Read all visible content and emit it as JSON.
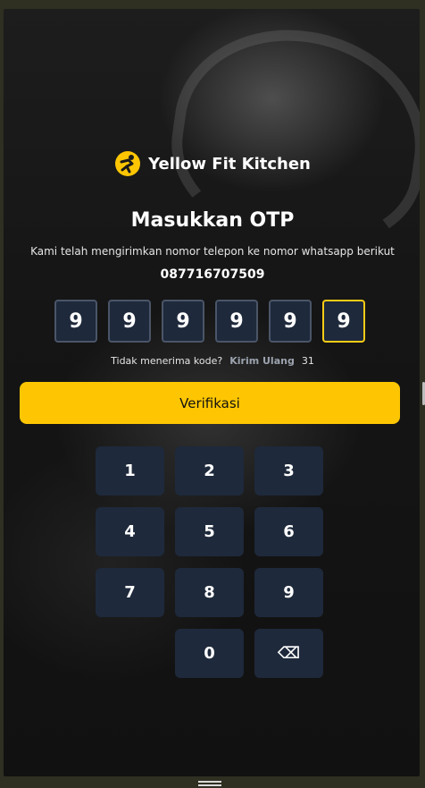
{
  "brand": {
    "name": "Yellow Fit Kitchen",
    "logo_icon": "running-person-icon",
    "accent_color": "#fec602"
  },
  "heading": {
    "title": "Masukkan OTP",
    "description": "Kami telah mengirimkan nomor telepon ke nomor whatsapp berikut",
    "phone_number": "087716707509"
  },
  "otp": {
    "digits": [
      "9",
      "9",
      "9",
      "9",
      "9",
      "9"
    ],
    "active_index": 5
  },
  "resend": {
    "prompt": "Tidak menerima kode?",
    "link_label": "Kirim Ulang",
    "countdown": "31"
  },
  "verify_button": {
    "label": "Verifikasi"
  },
  "keypad": {
    "keys": [
      "1",
      "2",
      "3",
      "4",
      "5",
      "6",
      "7",
      "8",
      "9",
      "0",
      "⌫"
    ],
    "backspace_icon": "backspace-icon"
  }
}
